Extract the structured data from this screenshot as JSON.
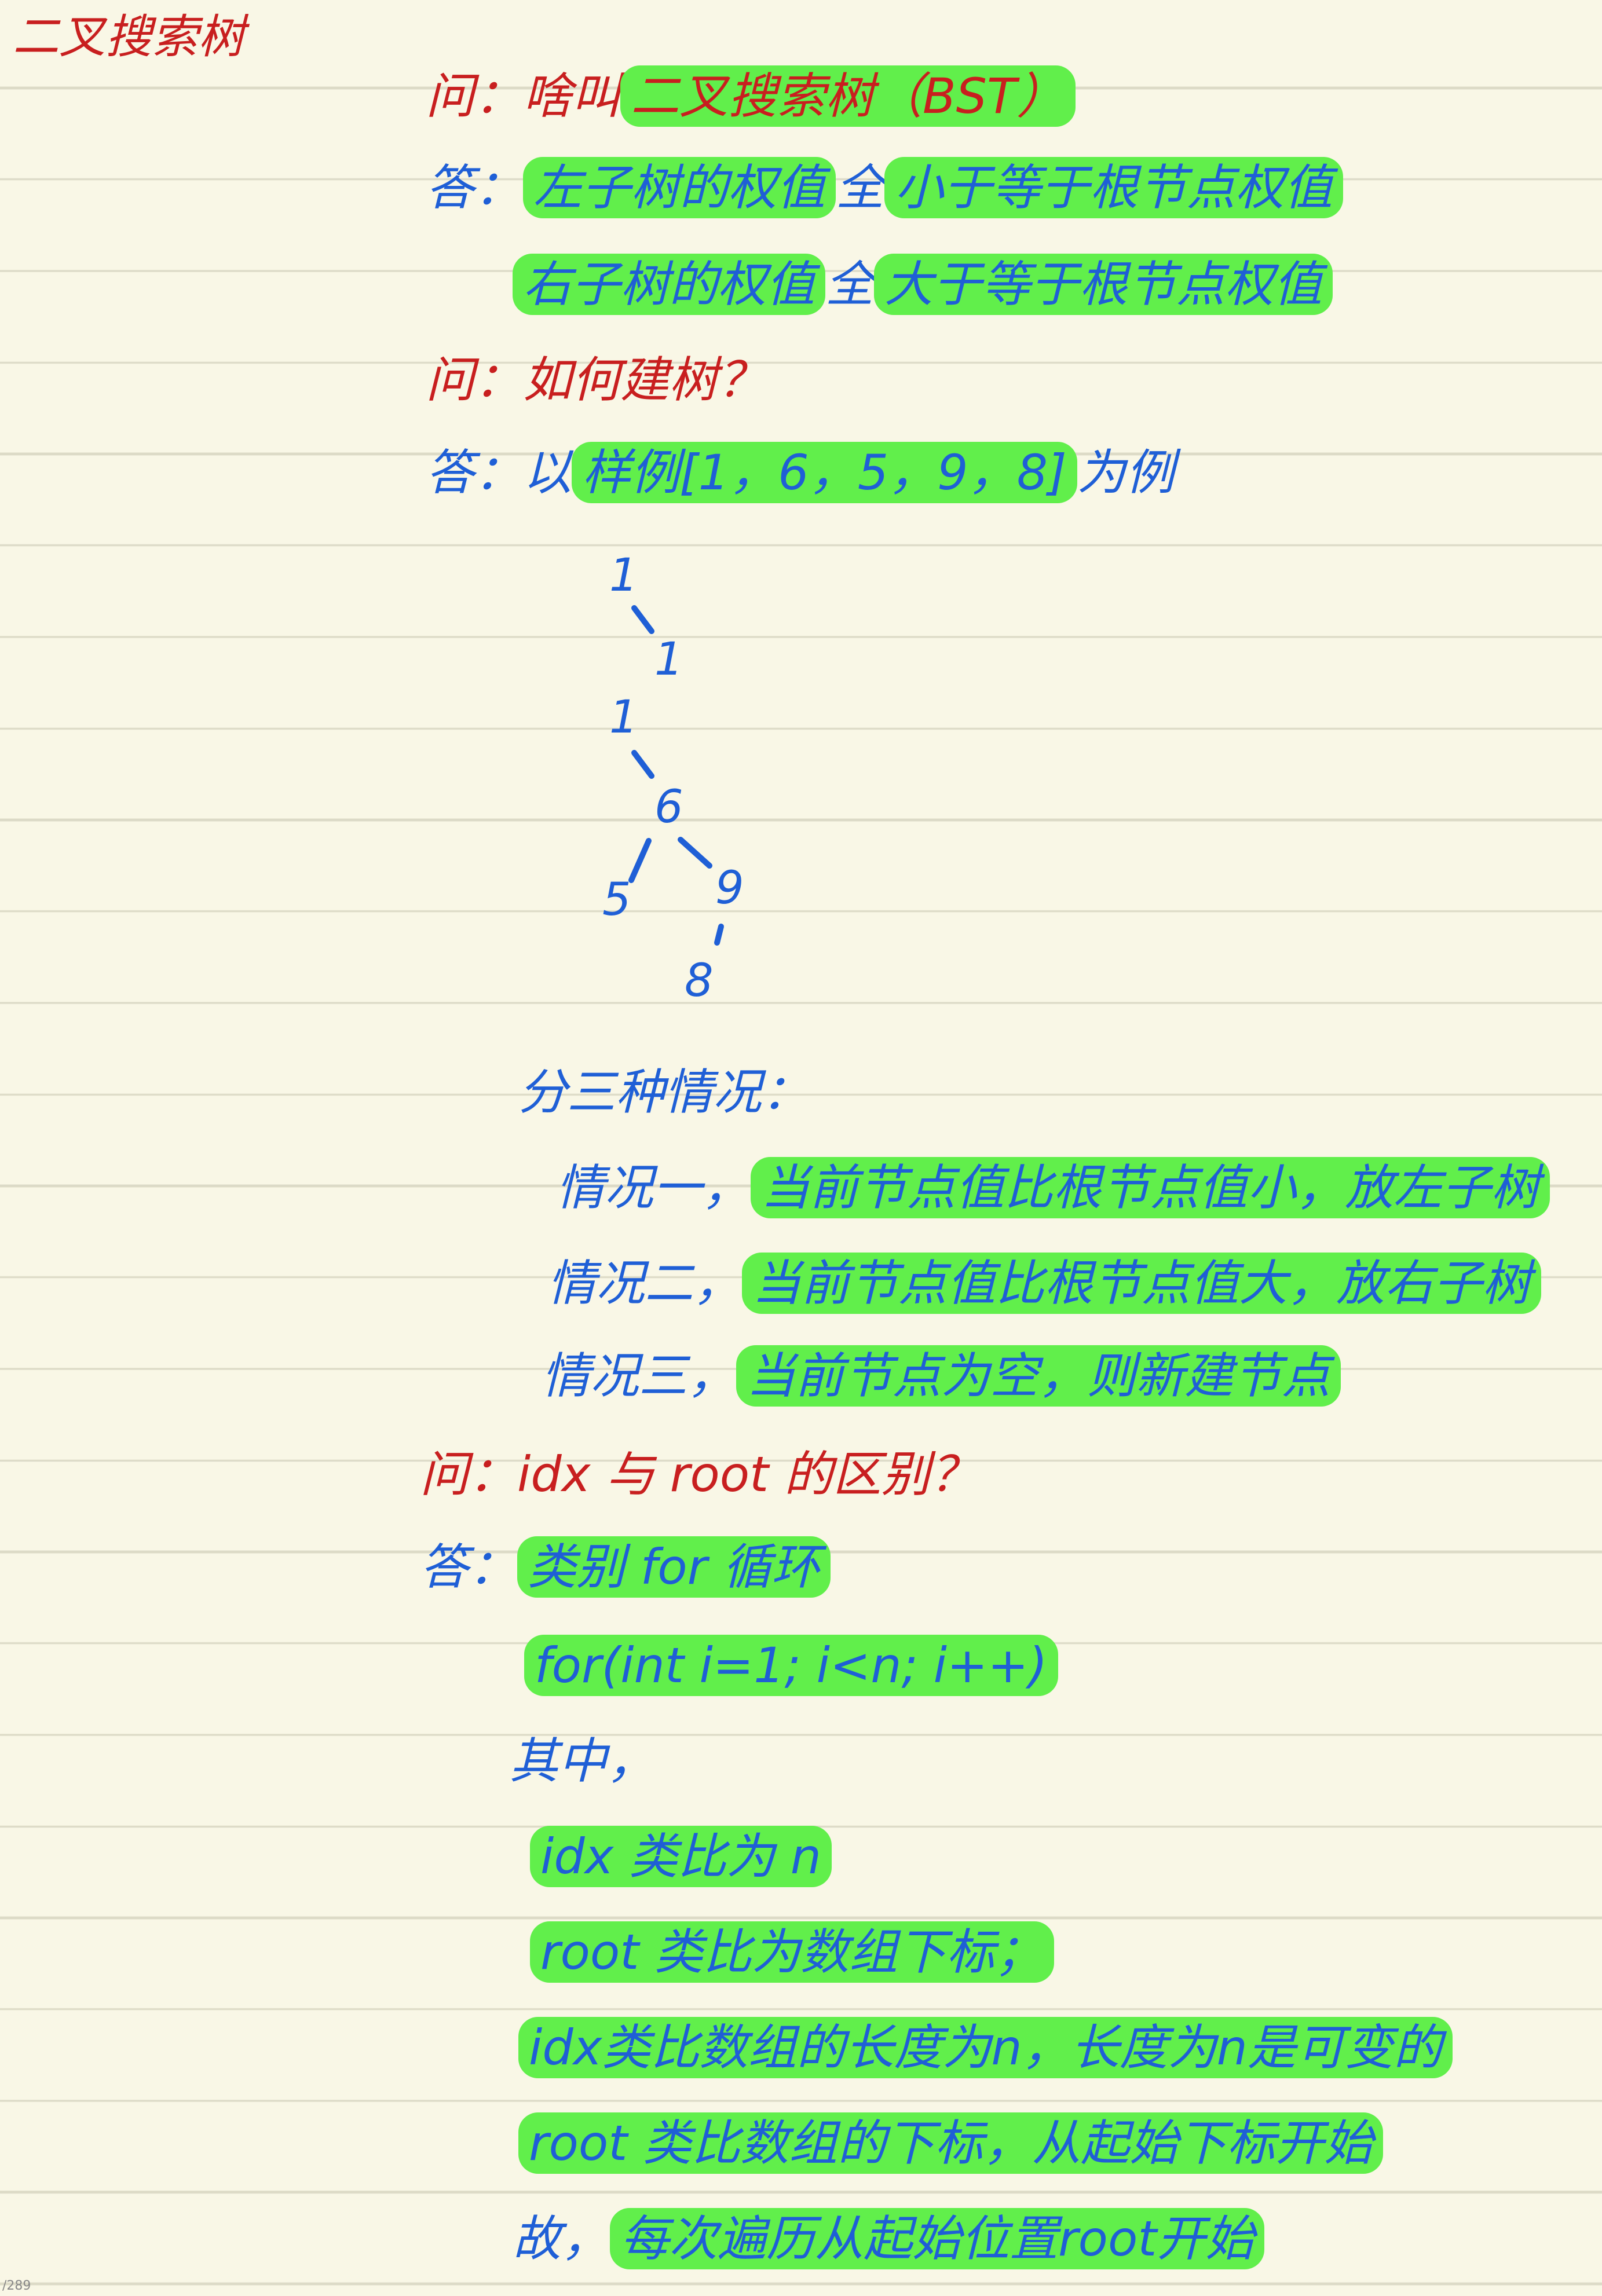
{
  "note": {
    "title": "二叉搜索树",
    "q1": {
      "prefix": "问：",
      "plain": "啥叫",
      "highlight": "二叉搜索树（BST）"
    },
    "a1": {
      "prefix": "答：",
      "line1": {
        "h1": "左子树的权值",
        "mid": "全",
        "h2": "小于等于根节点权值"
      },
      "line2": {
        "h1": "右子树的权值",
        "mid": "全",
        "h2": "大于等于根节点权值"
      }
    },
    "q2": {
      "prefix": "问：",
      "text": "如何建树？"
    },
    "a2": {
      "prefix": "答：",
      "plain1": "以",
      "highlight": "样例[1，6，5，9，8]",
      "plain2": "为例"
    },
    "tree": {
      "step1": {
        "root": "1",
        "child": "1"
      },
      "step2": {
        "root": "1",
        "n6": "6",
        "n5": "5",
        "n9": "9",
        "n8": "8"
      }
    },
    "cases": {
      "intro": "分三种情况：",
      "case1": {
        "label": "情况一，",
        "highlight": "当前节点值比根节点值小，放左子树"
      },
      "case2": {
        "label": "情况二，",
        "highlight": "当前节点值比根节点值大，放右子树"
      },
      "case3": {
        "label": "情况三，",
        "highlight": "当前节点为空，则新建节点"
      }
    },
    "q3": {
      "prefix": "问：",
      "text": "idx 与 root 的区别？"
    },
    "a3": {
      "prefix": "答：",
      "highlight": "类别 for 循环",
      "code": "for(int i=1; i<n; i++)",
      "amid": "其中，",
      "item1": "idx 类比为 n",
      "item2": "root 类比为数组下标；",
      "item3": "idx类比数组的长度为n，长度为n是可变的",
      "item4": "root 类比数组的下标，从起始下标开始",
      "conclusion": {
        "plain": "故，",
        "highlight": "每次遍历从起始位置root开始"
      }
    }
  },
  "page_number": "/289"
}
